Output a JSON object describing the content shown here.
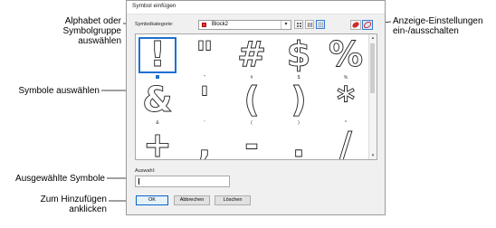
{
  "callouts": {
    "alphabet": "Alphabet oder Symbolgruppe auswählen",
    "symbols": "Symbole auswählen",
    "selected": "Ausgewählte Symbole",
    "add": "Zum Hinzufügen anklicken",
    "display": "Anzeige-Einstellungen ein-/ausschalten"
  },
  "dialog": {
    "title": "Symbol einfügen",
    "category_label": "Symbolkategorie:",
    "category_value": "Block2",
    "selection_label": "Auswahl:",
    "buttons": {
      "ok": "OK",
      "cancel": "Abbrechen",
      "clear": "Löschen"
    }
  },
  "symbols": [
    {
      "char": "!",
      "label": "",
      "selected": true
    },
    {
      "char": "\"",
      "label": "\""
    },
    {
      "char": "#",
      "label": "#"
    },
    {
      "char": "$",
      "label": "$"
    },
    {
      "char": "%",
      "label": "%"
    },
    {
      "char": "&",
      "label": "&"
    },
    {
      "char": "'",
      "label": "'"
    },
    {
      "char": "(",
      "label": "("
    },
    {
      "char": ")",
      "label": ")"
    },
    {
      "char": "*",
      "label": "*"
    },
    {
      "char": "+",
      "label": ""
    },
    {
      "char": ",",
      "label": ""
    },
    {
      "char": "-",
      "label": ""
    },
    {
      "char": ".",
      "label": ""
    },
    {
      "char": "/",
      "label": ""
    }
  ],
  "colors": {
    "selection": "#1f6fd1",
    "leader": "#000000"
  }
}
